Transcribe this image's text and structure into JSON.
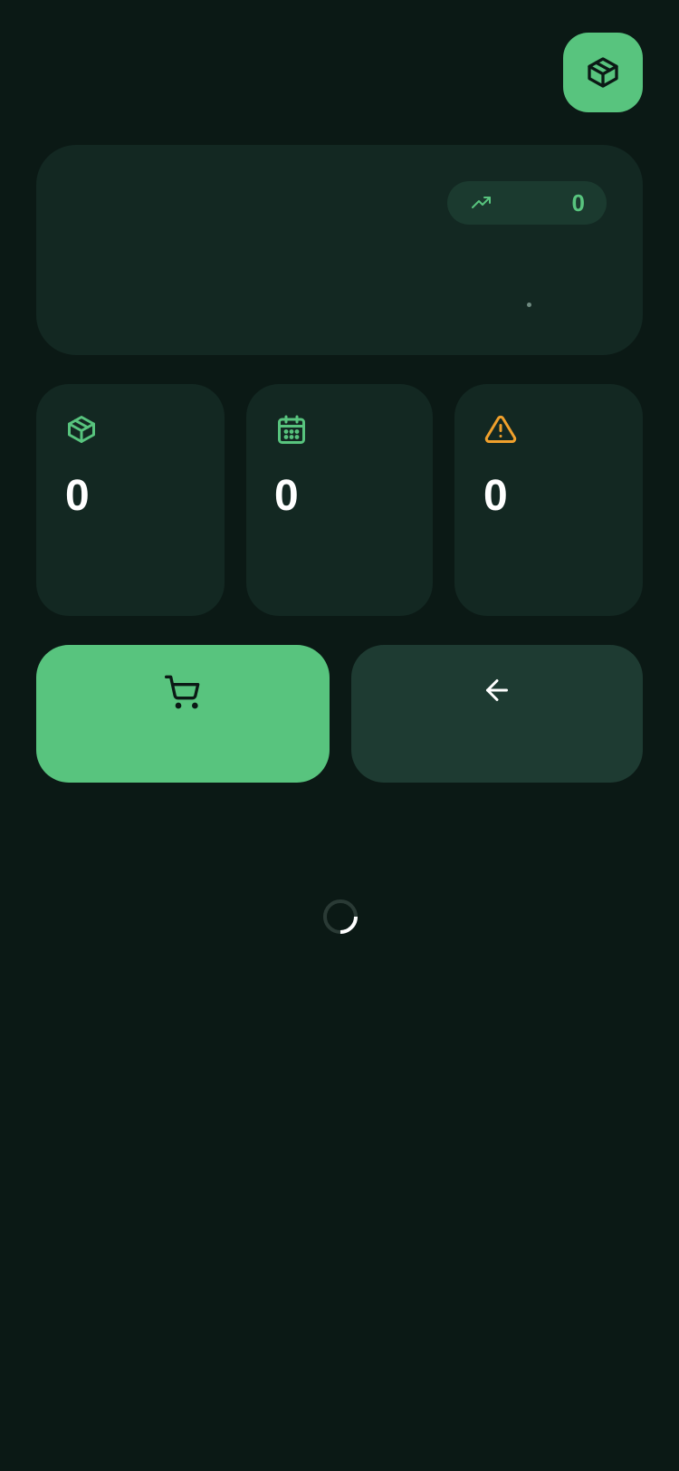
{
  "header": {
    "app_button_icon": "package-icon"
  },
  "hero": {
    "trend_icon": "trending-up-icon",
    "trend_value": "0"
  },
  "stats": [
    {
      "icon": "package-icon",
      "value": "0",
      "color": "#58c47e"
    },
    {
      "icon": "calendar-icon",
      "value": "0",
      "color": "#58c47e"
    },
    {
      "icon": "warning-icon",
      "value": "0",
      "color": "#f0a02c"
    }
  ],
  "actions": {
    "primary": {
      "icon": "shopping-cart-icon",
      "color": "#58c47e"
    },
    "secondary": {
      "icon": "arrow-left-icon",
      "color": "#1e3b32"
    }
  },
  "status": {
    "loading": true,
    "indicator": "loading-spinner"
  },
  "colors": {
    "background": "#0b1915",
    "card": "#132822",
    "accent": "#58c47e",
    "warning": "#f0a02c"
  }
}
